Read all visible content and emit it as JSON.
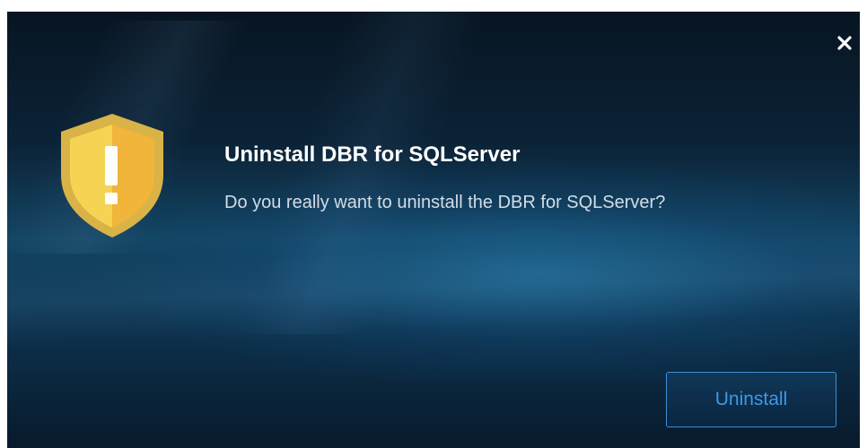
{
  "dialog": {
    "title": "Uninstall DBR for SQLServer",
    "message": "Do you really want to uninstall the DBR for SQLServer?",
    "close_icon": "close-icon",
    "warning_icon": "warning-shield-icon",
    "uninstall_label": "Uninstall"
  },
  "colors": {
    "background_dark": "#081522",
    "background_mid": "#134564",
    "shield_outer": "#d9b347",
    "shield_inner_light": "#f5d453",
    "shield_inner_dark": "#f0b53a",
    "button_border": "#3d8fd6",
    "button_text": "#3e98e6"
  }
}
